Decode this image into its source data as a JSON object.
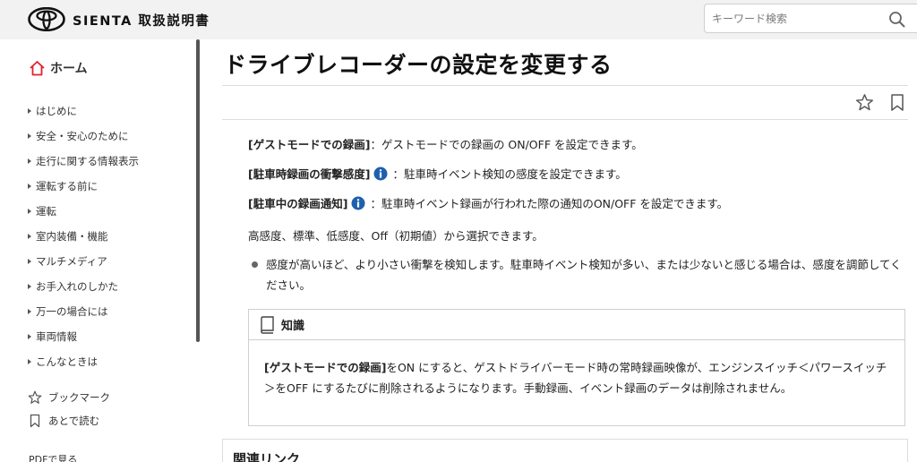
{
  "header": {
    "brand": "SIENTA 取扱説明書",
    "search_placeholder": "キーワード検索"
  },
  "sidebar": {
    "home_label": "ホーム",
    "items": [
      {
        "label": "はじめに"
      },
      {
        "label": "安全・安心のために"
      },
      {
        "label": "走行に関する情報表示"
      },
      {
        "label": "運転する前に"
      },
      {
        "label": "運転"
      },
      {
        "label": "室内装備・機能"
      },
      {
        "label": "マルチメディア"
      },
      {
        "label": "お手入れのしかた"
      },
      {
        "label": "万一の場合には"
      },
      {
        "label": "車両情報"
      },
      {
        "label": "こんなときは"
      }
    ],
    "bookmark_label": "ブックマーク",
    "read_later_label": "あとで読む",
    "pdf_label": "PDFで見る"
  },
  "main": {
    "title": "ドライブレコーダーの設定を変更する",
    "paragraphs": [
      {
        "bold": "[ゲストモードでの録画]",
        "text": "：ゲストモードでの録画の ON/OFF を設定できます。"
      },
      {
        "bold": "[駐車時録画の衝撃感度]",
        "text": "：駐車時イベント検知の感度を設定できます。"
      },
      {
        "bold": "[駐車中の録画通知]",
        "text": "：駐車時イベント録画が行われた際の通知のON/OFF を設定できます。"
      }
    ],
    "options_line": "高感度、標準、低感度、Off（初期値）から選択できます。",
    "bullet": "感度が高いほど、より小さい衝撃を検知します。駐車時イベント検知が多い、または少ないと感じる場合は、感度を調節してください。",
    "knowledge": {
      "heading": "知識",
      "bold": "[ゲストモードでの録画]",
      "text": "をON にすると、ゲストドライバーモード時の常時録画映像が、エンジンスイッチ＜パワースイッチ＞をOFF にするたびに削除されるようになります。手動録画、イベント録画のデータは削除されません。"
    },
    "related_heading": "関連リンク"
  },
  "colors": {
    "home_icon": "#e0232e",
    "info_icon": "#1f5fae"
  }
}
